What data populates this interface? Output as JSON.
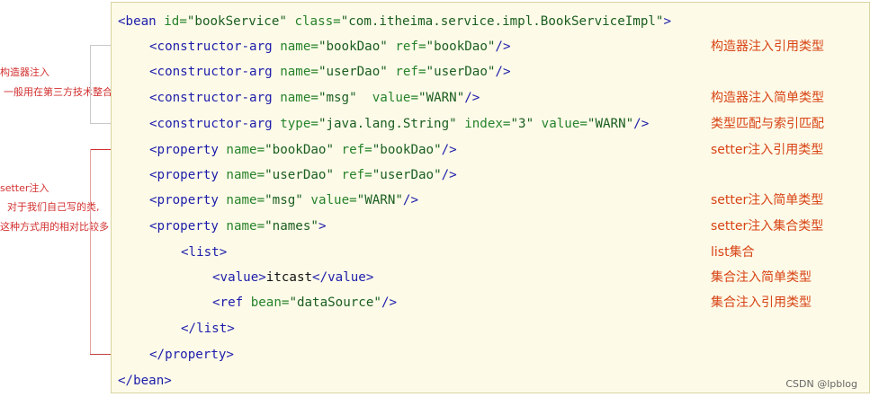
{
  "side_annotations": {
    "constructor_title": "构造器注入",
    "constructor_desc": "一般用在第三方技术整合",
    "setter_title": "setter注入",
    "setter_desc1": "对于我们自己写的类,",
    "setter_desc2": "这种方式用的相对比较多"
  },
  "code": {
    "line1": {
      "tag_open": "<bean ",
      "a1": "id=",
      "v1": "\"bookService\"",
      "a2": " class=",
      "v2": "\"com.itheima.service.impl.BookServiceImpl\"",
      "tag_close": ">"
    },
    "line2": {
      "tag_open": "<constructor-arg ",
      "a1": "name=",
      "v1": "\"bookDao\"",
      "a2": " ref=",
      "v2": "\"bookDao\"",
      "tag_close": "/>"
    },
    "line3": {
      "tag_open": "<constructor-arg ",
      "a1": "name=",
      "v1": "\"userDao\"",
      "a2": " ref=",
      "v2": "\"userDao\"",
      "tag_close": "/>"
    },
    "line4": {
      "tag_open": "<constructor-arg ",
      "a1": "name=",
      "v1": "\"msg\"",
      "a2": "  value=",
      "v2": "\"WARN\"",
      "tag_close": "/>"
    },
    "line5": {
      "tag_open": "<constructor-arg ",
      "a1": "type=",
      "v1": "\"java.lang.String\"",
      "a2": " index=",
      "v2": "\"3\"",
      "a3": " value=",
      "v3": "\"WARN\"",
      "tag_close": "/>"
    },
    "line6": {
      "tag_open": "<property ",
      "a1": "name=",
      "v1": "\"bookDao\"",
      "a2": " ref=",
      "v2": "\"bookDao\"",
      "tag_close": "/>"
    },
    "line7": {
      "tag_open": "<property ",
      "a1": "name=",
      "v1": "\"userDao\"",
      "a2": " ref=",
      "v2": "\"userDao\"",
      "tag_close": "/>"
    },
    "line8": {
      "tag_open": "<property ",
      "a1": "name=",
      "v1": "\"msg\"",
      "a2": " value=",
      "v2": "\"WARN\"",
      "tag_close": "/>"
    },
    "line9": {
      "tag_open": "<property ",
      "a1": "name=",
      "v1": "\"names\"",
      "tag_close": ">"
    },
    "line10": {
      "tag": "<list>"
    },
    "line11": {
      "tag_open": "<value>",
      "text": "itcast",
      "tag_close": "</value>"
    },
    "line12": {
      "tag_open": "<ref ",
      "a1": "bean=",
      "v1": "\"dataSource\"",
      "tag_close": "/>"
    },
    "line13": {
      "tag": "</list>"
    },
    "line14": {
      "tag": "</property>"
    },
    "line15": {
      "tag": "</bean>"
    }
  },
  "notes": {
    "n2": "构造器注入引用类型",
    "n4": "构造器注入简单类型",
    "n5": "类型匹配与索引匹配",
    "n6": "setter注入引用类型",
    "n8": "setter注入简单类型",
    "n9": "setter注入集合类型",
    "n10": "list集合",
    "n11": "集合注入简单类型",
    "n12": "集合注入引用类型"
  },
  "watermark": "CSDN @lpblog",
  "colors": {
    "tag": "#1d1daa",
    "attr": "#27832b",
    "note": "#d84315",
    "side": "#d32f2f"
  }
}
